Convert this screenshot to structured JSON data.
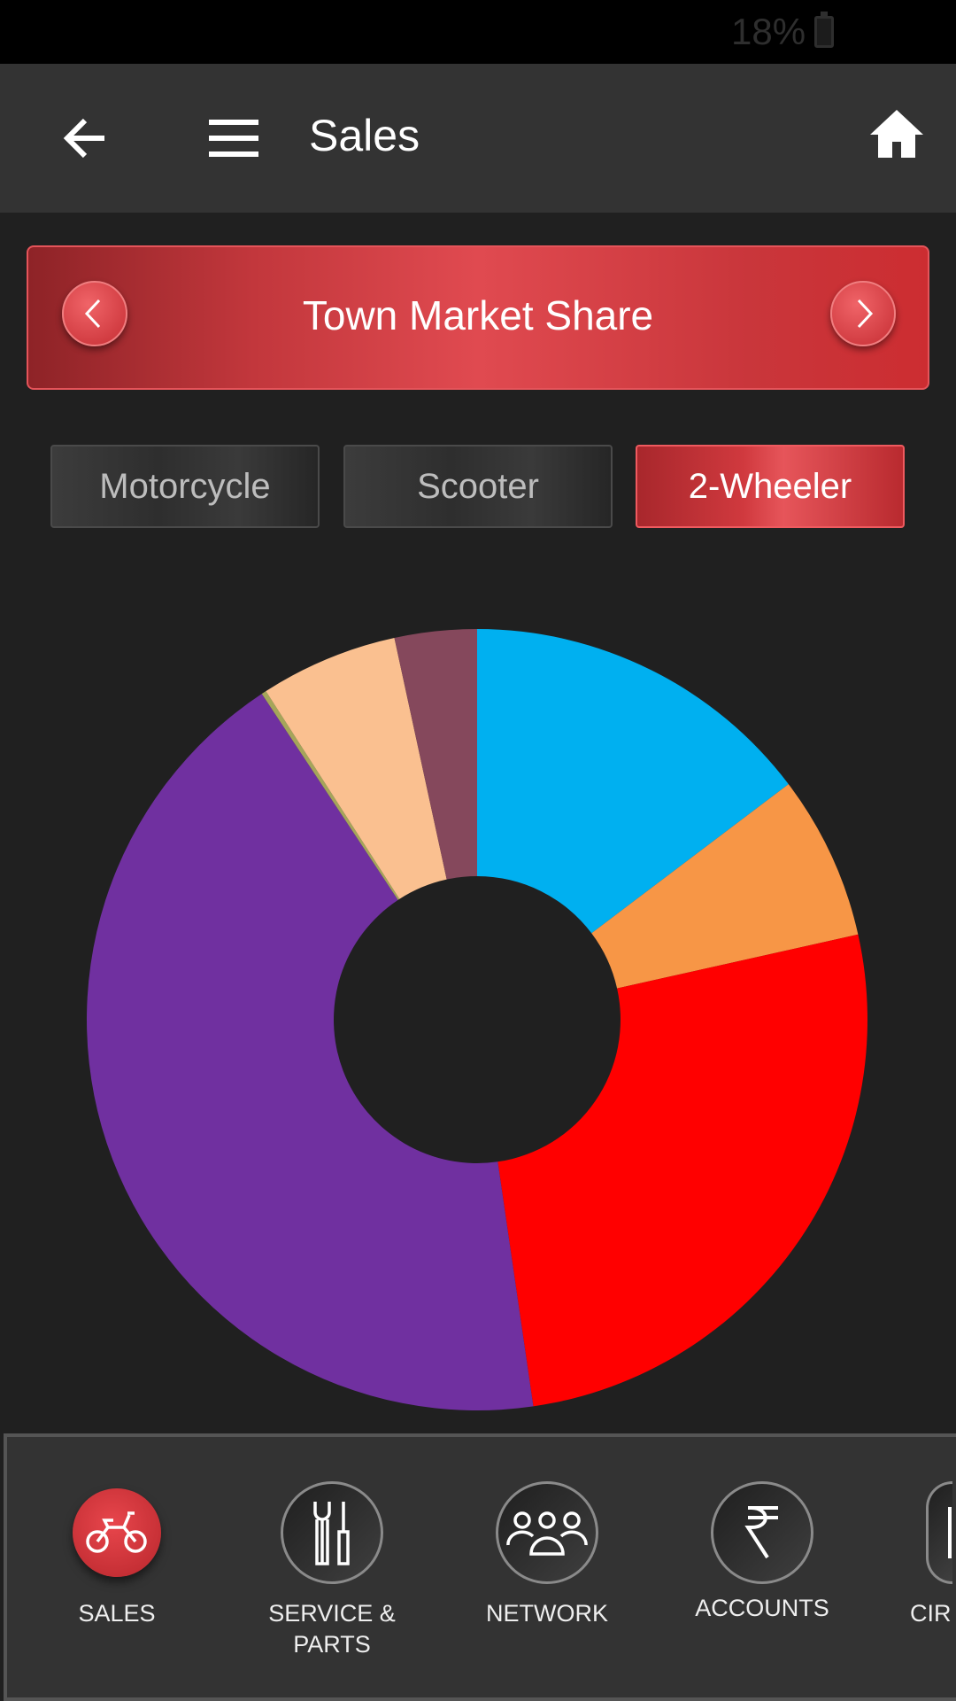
{
  "status_bar": {
    "battery": "18%"
  },
  "app_bar": {
    "title": "Sales",
    "icons": [
      "back-arrow-icon",
      "menu-icon",
      "home-icon"
    ]
  },
  "banner": {
    "title": "Town Market Share",
    "icons": [
      "chevron-left-icon",
      "chevron-right-icon"
    ]
  },
  "tabs": [
    {
      "label": "Motorcycle",
      "active": false
    },
    {
      "label": "Scooter",
      "active": false
    },
    {
      "label": "2-Wheeler",
      "active": true
    }
  ],
  "chart_data": {
    "type": "pie",
    "donut": true,
    "title": "",
    "start": "top, clockwise",
    "slices": [
      {
        "value": 14.7,
        "color": "#00b0f0"
      },
      {
        "value": 6.8,
        "color": "#f79646"
      },
      {
        "value": 26.2,
        "color": "#ff0000"
      },
      {
        "value": 43.0,
        "color": "#7030a0"
      },
      {
        "value": 0.2,
        "color": "#a5a55a"
      },
      {
        "value": 5.7,
        "color": "#fac090"
      },
      {
        "value": 3.4,
        "color": "#85485c"
      }
    ],
    "legend": "none"
  },
  "bottom_nav": [
    {
      "label": "SALES",
      "icon": "motorcycle-icon",
      "active": true
    },
    {
      "label": "SERVICE & PARTS",
      "icon": "tools-icon",
      "active": false
    },
    {
      "label": "NETWORK",
      "icon": "people-group-icon",
      "active": false
    },
    {
      "label": "ACCOUNTS",
      "icon": "rupee-icon",
      "active": false
    },
    {
      "label": "CIR",
      "icon": "document-icon",
      "active": false
    }
  ],
  "colors": {
    "accent": "#d9363c",
    "background": "#202020",
    "bar": "#333333"
  }
}
